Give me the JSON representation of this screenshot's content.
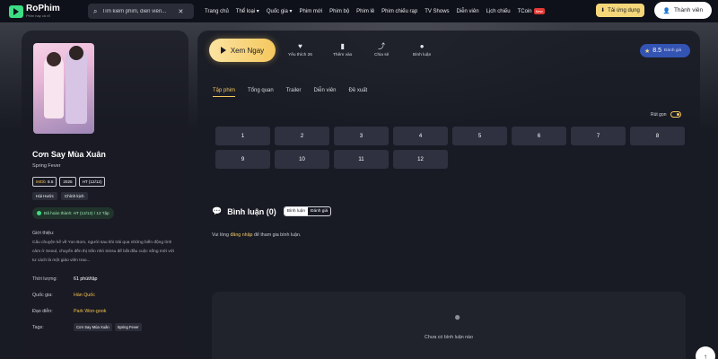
{
  "header": {
    "logo_name": "RoPhim",
    "logo_sub": "Phim hay cả rổ",
    "search_placeholder": "Tìm kiếm phim, diễn viên...",
    "nav": [
      "Trang chủ",
      "Thể loại ▾",
      "Quốc gia ▾",
      "Phim mới",
      "Phim bộ",
      "Phim lẻ",
      "Phim chiếu rạp",
      "TV Shows",
      "Diễn viên",
      "Lịch chiếu",
      "TCoin"
    ],
    "tcoin_badge": "New",
    "app_button": "Tải ứng dụng",
    "member_button": "Thành viên"
  },
  "movie": {
    "title": "Cơn Say Mùa Xuân",
    "original_title": "Spring Fever",
    "imdb_label": "IMDb",
    "imdb_score": "8.5",
    "year": "2025",
    "episodes_tag": "HT (12/12)",
    "genres": [
      "Hài Hước",
      "Chính kịch"
    ],
    "status": "Đã hoàn thành: HT (12/12) / 12 Tập",
    "intro_label": "Giới thiệu:",
    "intro_text": "Câu chuyện kể về Yun Bom, người sau khi trải qua những biến động tình cảm ở Seoul, chuyển đến thị trấn nhỏ Sinsu để bắt đầu cuộc sống mới với tư cách là một giáo viên trao...",
    "duration_label": "Thời lượng:",
    "duration": "61 phút/tập",
    "country_label": "Quốc gia:",
    "country": "Hàn Quốc",
    "director_label": "Đạo diễn:",
    "director": "Park Won-gook",
    "tags_label": "Tags:",
    "tags": [
      "Cơn Say Mùa Xuân",
      "Spring Fever"
    ]
  },
  "actions": {
    "play": "Xem Ngay",
    "like": "Yêu thích 26",
    "add": "Thêm vào",
    "share": "Chia sẻ",
    "comment": "Bình luận",
    "rating": "8.5",
    "rating_sub": "Đánh giá"
  },
  "tabs": [
    "Tập phim",
    "Tổng quan",
    "Trailer",
    "Diễn viên",
    "Đề xuất"
  ],
  "collapse_label": "Rút gọn",
  "episodes": [
    "1",
    "2",
    "3",
    "4",
    "5",
    "6",
    "7",
    "8",
    "9",
    "10",
    "11",
    "12"
  ],
  "comments": {
    "title": "Bình luận (0)",
    "toggle_on": "Bình luận",
    "toggle_off": "Đánh giá",
    "login_prefix": "Vui lòng",
    "login_link": "đăng nhập",
    "login_suffix": "để tham gia bình luận.",
    "empty": "Chưa có bình luận nào"
  },
  "colors": {
    "accent": "#f5c85e",
    "background": "#191b24",
    "rating_bg": "#3454b4"
  }
}
